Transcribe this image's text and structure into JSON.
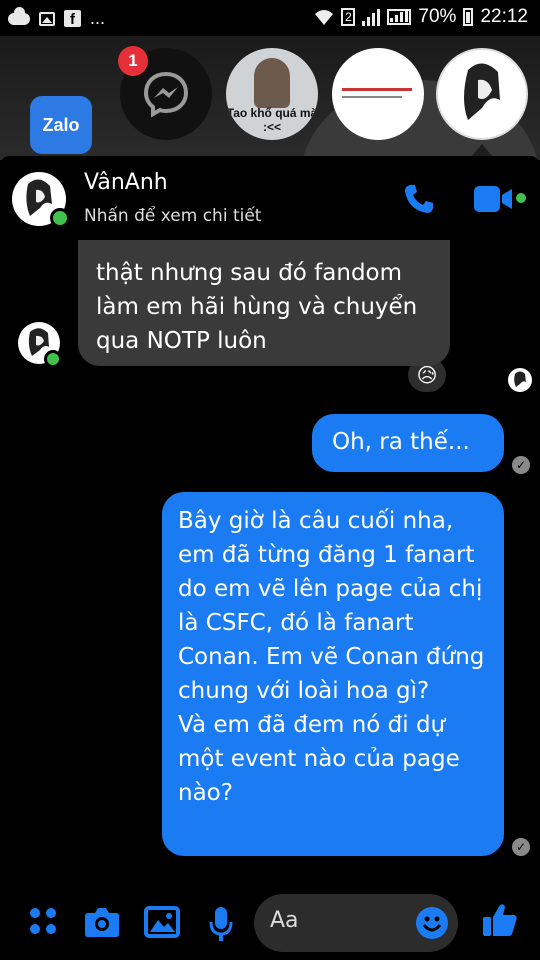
{
  "status_bar": {
    "overflow": "...",
    "sim_number": "2",
    "battery": "70%",
    "time": "22:12"
  },
  "home": {
    "app_label": "Zalo"
  },
  "chat_heads": {
    "messenger_badge": "1",
    "head2_caption": "Tao khổ quá mà :<<"
  },
  "header": {
    "name": "VânAnh",
    "subtitle": "Nhấn để xem chi tiết"
  },
  "messages": {
    "incoming": "thật nhưng sau đó fandom làm em hãi hùng và chuyển qua NOTP luôn",
    "incoming_reaction": "😥",
    "outgoing_1": "Oh, ra thế...",
    "outgoing_2": "Bây giờ là câu cuối nha, em đã từng đăng 1 fanart do em vẽ lên page của chị là CSFC, đó là fanart Conan. Em vẽ Conan đứng chung với loài hoa gì?\nVà em đã đem nó đi dự một event nào của page nào?"
  },
  "composer": {
    "placeholder": "Aa"
  },
  "colors": {
    "accent": "#1a7bf2",
    "incoming_bubble": "#3a3a3a",
    "online": "#41c24a",
    "badge": "#e5303a"
  },
  "icons": [
    "menu-dots-icon",
    "camera-icon",
    "gallery-icon",
    "microphone-icon",
    "emoji-icon",
    "like-icon",
    "phone-icon",
    "video-icon",
    "messenger-icon"
  ]
}
